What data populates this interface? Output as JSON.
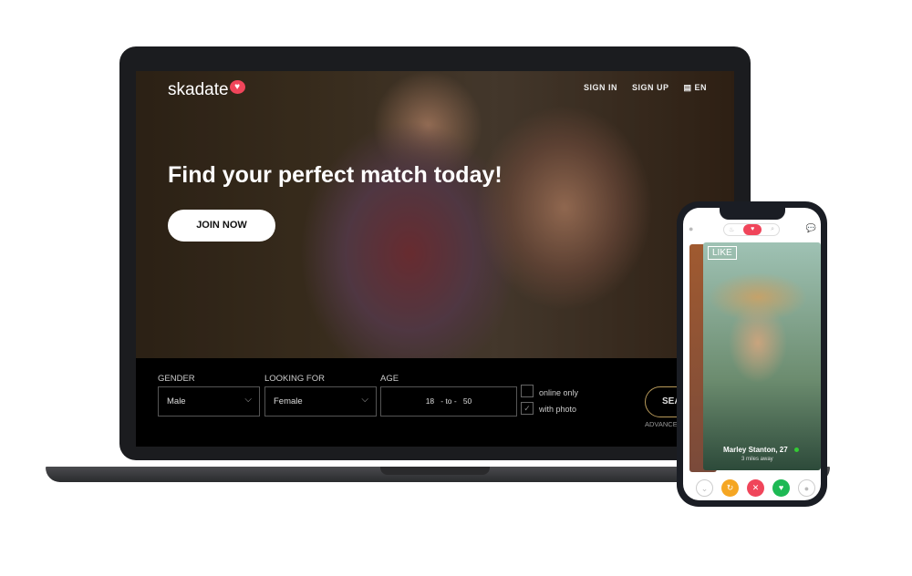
{
  "site": {
    "logo": "skadate",
    "nav": [
      "SIGN IN",
      "SIGN UP",
      "EN"
    ]
  },
  "hero": {
    "headline": "Find your perfect match today!",
    "join_label": "JOIN NOW"
  },
  "search": {
    "gender_label": "GENDER",
    "gender_value": "Male",
    "looking_label": "LOOKING FOR",
    "looking_value": "Female",
    "age_label": "AGE",
    "age_from": "18",
    "age_sep": "- to -",
    "age_to": "50",
    "online_only": "online only",
    "with_photo": "with photo",
    "with_photo_checked": true,
    "search_label": "SEAR",
    "advanced_label": "ADVANCE"
  },
  "phone": {
    "like_label": "LIKE",
    "profile_name": "Marley Stanton, 27",
    "profile_distance": "3 miles away",
    "colors": {
      "accent": "#f0455a",
      "undo": "#f5a623",
      "dislike": "#f0455a",
      "like": "#1db954"
    }
  }
}
